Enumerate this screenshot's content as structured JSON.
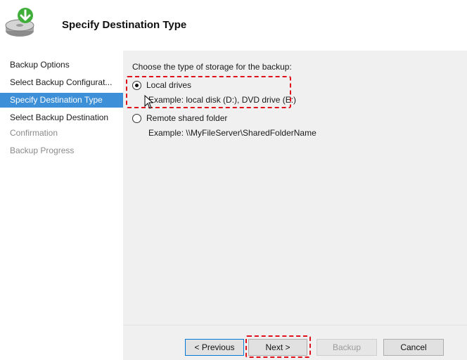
{
  "header": {
    "title": "Specify Destination Type",
    "icon": "backup-disk-icon"
  },
  "sidebar": {
    "items": [
      {
        "label": "Backup Options",
        "state": "normal"
      },
      {
        "label": "Select Backup Configurat...",
        "state": "normal"
      },
      {
        "label": "Specify Destination Type",
        "state": "active"
      },
      {
        "label": "Select Backup Destination",
        "state": "normal"
      },
      {
        "label": "Confirmation",
        "state": "disabled"
      },
      {
        "label": "Backup Progress",
        "state": "disabled"
      }
    ]
  },
  "main": {
    "instruction": "Choose the type of storage for the backup:",
    "options": [
      {
        "label": "Local drives",
        "example": "Example: local disk (D:), DVD drive (E:)",
        "selected": true
      },
      {
        "label": "Remote shared folder",
        "example": "Example: \\\\MyFileServer\\SharedFolderName",
        "selected": false
      }
    ]
  },
  "buttons": {
    "previous": "< Previous",
    "next": "Next >",
    "backup": "Backup",
    "cancel": "Cancel"
  },
  "colors": {
    "active_nav": "#3d8fd8",
    "highlight": "#e0101a",
    "panel_bg": "#f0f0f0"
  }
}
